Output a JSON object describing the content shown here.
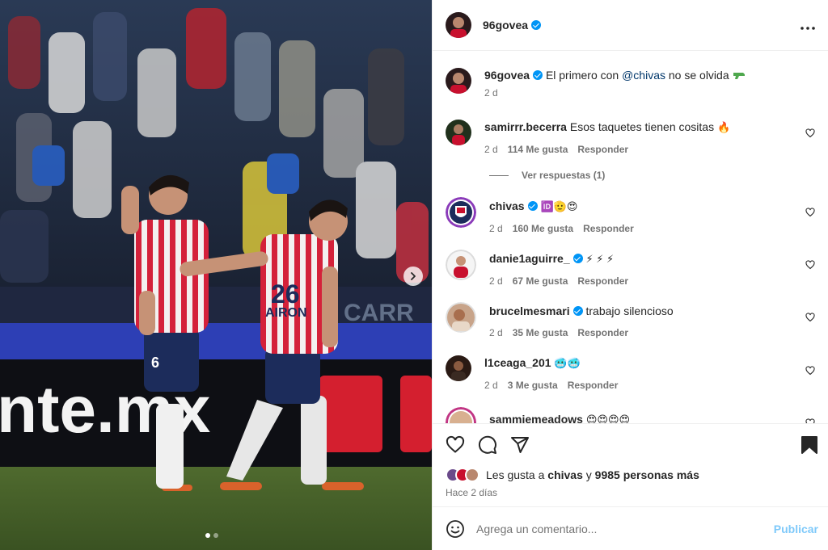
{
  "post": {
    "author": "96govea",
    "caption_author": "96govea",
    "caption_text": "El primero con",
    "caption_mention": "@chivas",
    "caption_rest": "no se olvida",
    "caption_time": "2 d"
  },
  "photo": {
    "next_icon": "chevron-right-icon",
    "slides_total": 2,
    "slides_active": 1
  },
  "comments": [
    {
      "user": "samirrr.becerra",
      "verified": false,
      "text": "Esos taquetes tienen cositas",
      "emoji": "🔥",
      "time": "2 d",
      "likes": "114 Me gusta",
      "reply": "Responder",
      "view_replies": "Ver respuestas (1)"
    },
    {
      "user": "chivas",
      "verified": true,
      "text": "",
      "emoji": "🆔🫡😍",
      "time": "2 d",
      "likes": "160 Me gusta",
      "reply": "Responder"
    },
    {
      "user": "danie1aguirre_",
      "verified": true,
      "text": "",
      "emoji": "⚡ ⚡ ⚡",
      "time": "2 d",
      "likes": "67 Me gusta",
      "reply": "Responder"
    },
    {
      "user": "brucelmesmari",
      "verified": true,
      "text": "trabajo silencioso",
      "emoji": "",
      "time": "2 d",
      "likes": "35 Me gusta",
      "reply": "Responder"
    },
    {
      "user": "l1ceaga_201",
      "verified": false,
      "text": "",
      "emoji": "🥶🥶",
      "time": "2 d",
      "likes": "3 Me gusta",
      "reply": "Responder"
    },
    {
      "user": "sammiemeadows",
      "verified": false,
      "text": "",
      "emoji": "😍😍😍😍",
      "time": "",
      "likes": "",
      "reply": ""
    }
  ],
  "actions": {
    "like_icon": "heart-icon",
    "comment_icon": "comment-icon",
    "share_icon": "share-icon",
    "save_icon": "bookmark-icon",
    "likes_prefix": "Les gusta a",
    "likes_user": "chivas",
    "likes_and": "y",
    "likes_others": "9985 personas más",
    "time_ago": "Hace 2 días"
  },
  "add_comment": {
    "emoji_icon": "smiley-icon",
    "placeholder": "Agrega un comentario...",
    "publish_label": "Publicar"
  },
  "colors": {
    "accent": "#0095f6",
    "text": "#262626",
    "muted": "#737373",
    "chivas_red": "#c8102e",
    "chivas_navy": "#1c2c5b"
  }
}
